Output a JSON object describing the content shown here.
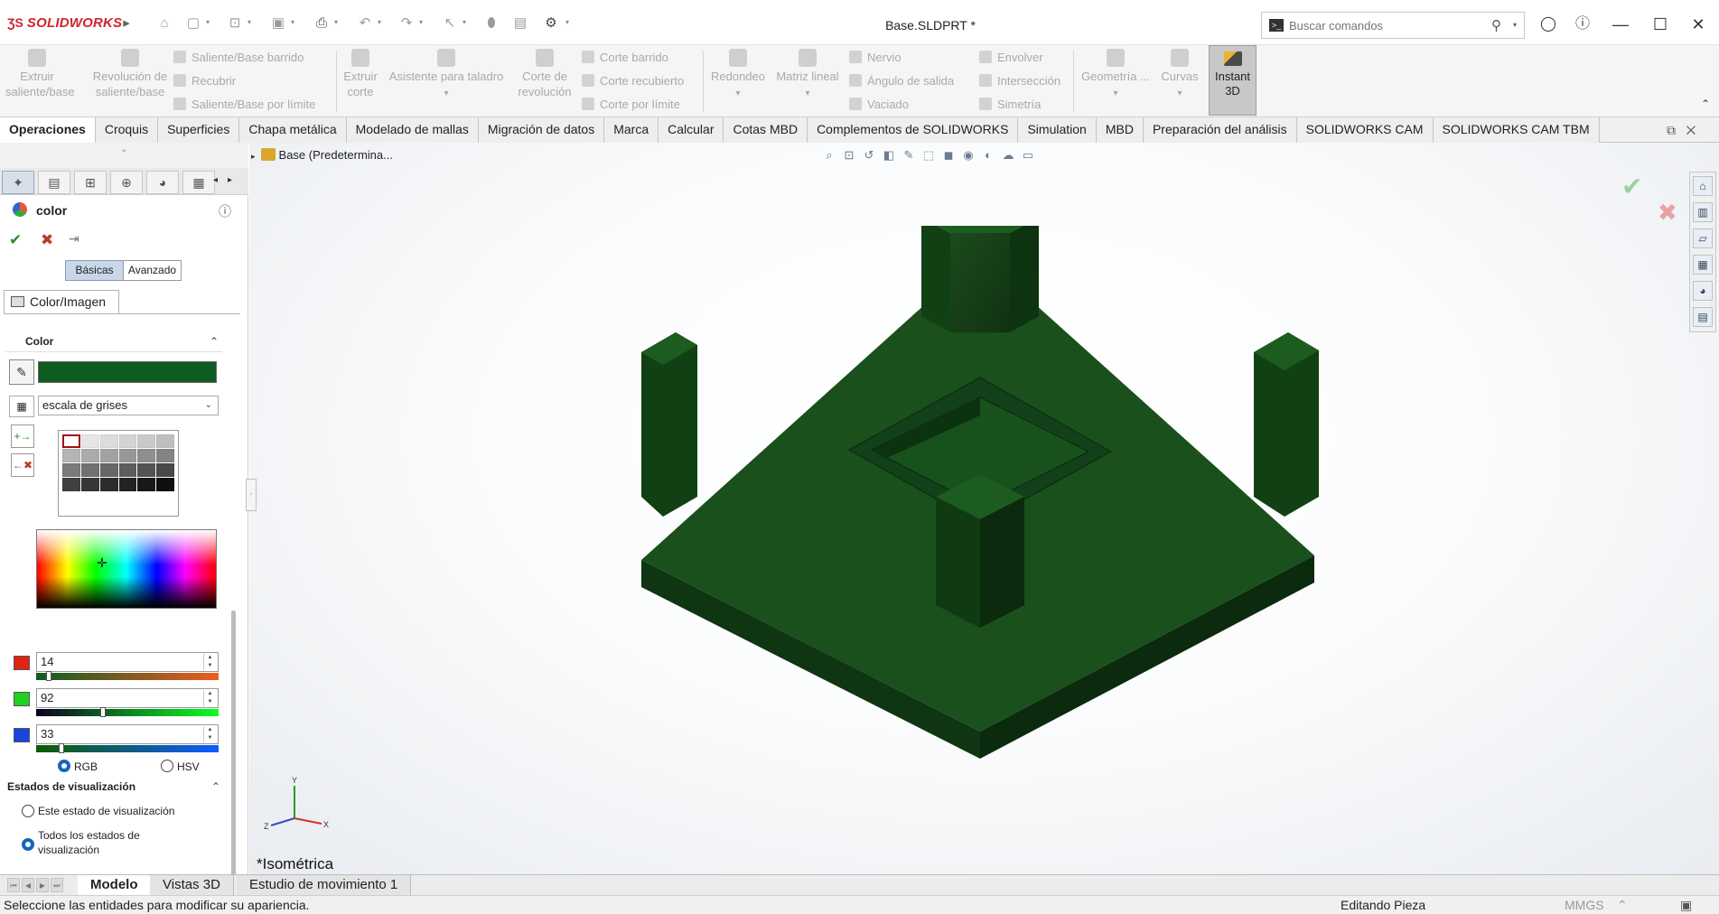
{
  "app": {
    "brand": "SOLIDWORKS",
    "document_title": "Base.SLDPRT *"
  },
  "search": {
    "placeholder": "Buscar comandos"
  },
  "ribbon": {
    "big_buttons": [
      {
        "label_lines": [
          "Extruir",
          "saliente/base"
        ],
        "enabled": false
      },
      {
        "label_lines": [
          "Revolución de",
          "saliente/base"
        ],
        "enabled": false
      },
      {
        "label_lines": [
          "Extruir",
          "corte"
        ],
        "enabled": false
      },
      {
        "label_lines": [
          "Asistente para taladro"
        ],
        "enabled": false
      },
      {
        "label_lines": [
          "Corte de",
          "revolución"
        ],
        "enabled": false
      },
      {
        "label_lines": [
          "Redondeo"
        ],
        "enabled": false
      },
      {
        "label_lines": [
          "Matriz lineal"
        ],
        "enabled": false
      },
      {
        "label_lines": [
          "Geometría ..."
        ],
        "enabled": false
      },
      {
        "label_lines": [
          "Curvas"
        ],
        "enabled": false
      }
    ],
    "small_buttons": {
      "col1": [
        "Saliente/Base barrido",
        "Recubrir",
        "Saliente/Base por límite"
      ],
      "col2": [
        "Corte barrido",
        "Corte recubierto",
        "Corte por límite"
      ],
      "col3": [
        "Nervio",
        "Ángulo de salida",
        "Vaciado"
      ],
      "col4": [
        "Envolver",
        "Intersección",
        "Simetría"
      ]
    },
    "instant3d": {
      "line1": "Instant",
      "line2": "3D",
      "active": true
    }
  },
  "tabs": [
    "Operaciones",
    "Croquis",
    "Superficies",
    "Chapa metálica",
    "Modelado de mallas",
    "Migración de datos",
    "Marca",
    "Calcular",
    "Cotas MBD",
    "Complementos de SOLIDWORKS",
    "Simulation",
    "MBD",
    "Preparación del análisis",
    "SOLIDWORKS CAM",
    "SOLIDWORKS CAM TBM"
  ],
  "active_tab": "Operaciones",
  "property_manager": {
    "title": "color",
    "modes": {
      "basic": "Básicas",
      "advanced": "Avanzado"
    },
    "subtab": "Color/Imagen",
    "color_section": "Color",
    "current_color": "#0e5c21",
    "palette": "escala de grises",
    "rgb": {
      "r": "14",
      "g": "92",
      "b": "33"
    },
    "rgb_fraction": {
      "r": 0.055,
      "g": 0.36,
      "b": 0.13
    },
    "model_rgb": "RGB",
    "model_hsv": "HSV",
    "model_selected": "RGB",
    "display_states": {
      "header": "Estados de visualización",
      "option_this": "Este estado de visualización",
      "option_all_l1": "Todos los estados de",
      "option_all_l2": "visualización",
      "selected": "all"
    }
  },
  "viewport": {
    "tree_root": "Base (Predetermina...",
    "view_name": "*Isométrica",
    "triad": {
      "x": "X",
      "y": "Y",
      "z": "Z"
    },
    "model_color": "#0e5c21"
  },
  "bottom_tabs": [
    "Modelo",
    "Vistas 3D",
    "Estudio de movimiento 1"
  ],
  "status": {
    "message": "Seleccione las entidades para modificar su apariencia.",
    "mode": "Editando Pieza",
    "units": "MMGS"
  }
}
